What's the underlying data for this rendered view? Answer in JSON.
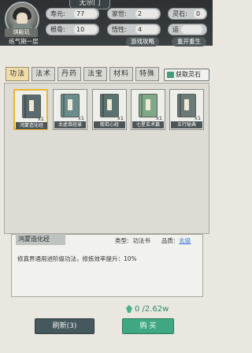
{
  "header": {
    "sect": "无宗门",
    "player_name": "琪殿玑",
    "realm": "练气期一层",
    "stats": [
      {
        "label": "寿元:",
        "value": "77"
      },
      {
        "label": "家世:",
        "value": "2"
      },
      {
        "label": "灵石:",
        "value": "0"
      },
      {
        "label": "根骨:",
        "value": "10"
      },
      {
        "label": "悟性:",
        "value": "4"
      },
      {
        "label": "运",
        "value": ""
      }
    ],
    "game_guide": "游戏攻略",
    "reincarnate": "重开重生"
  },
  "tabs": [
    "功法",
    "法术",
    "丹药",
    "法宝",
    "材料",
    "特殊"
  ],
  "get_spirit_stone": "获取灵石",
  "items": [
    {
      "name": "鸿蒙造化经",
      "count": "x1",
      "color": "#5a6b70"
    },
    {
      "name": "太虚真经录",
      "count": "x1",
      "color": "#6a8c8a"
    },
    {
      "name": "般若心经",
      "count": "x1",
      "color": "#5b7270"
    },
    {
      "name": "七星玄术篇",
      "count": "x1",
      "color": "#7fa889"
    },
    {
      "name": "五行秘典",
      "count": "x1",
      "color": "#6b7a79"
    }
  ],
  "detail": {
    "title": "鸿蒙造化经",
    "type_label": "类型:",
    "type_value": "功法书",
    "quality_label": "品质:",
    "quality_value": "玄级",
    "description": "修真界通用进阶级功法，修炼效率提升：10%"
  },
  "price": "0 /2.62w",
  "refresh_button": "刷新(3)",
  "buy_button": "购 买",
  "colors": {
    "accent": "#3fa883",
    "selected": "#e9b52c",
    "quality": "#3c7bd6"
  }
}
